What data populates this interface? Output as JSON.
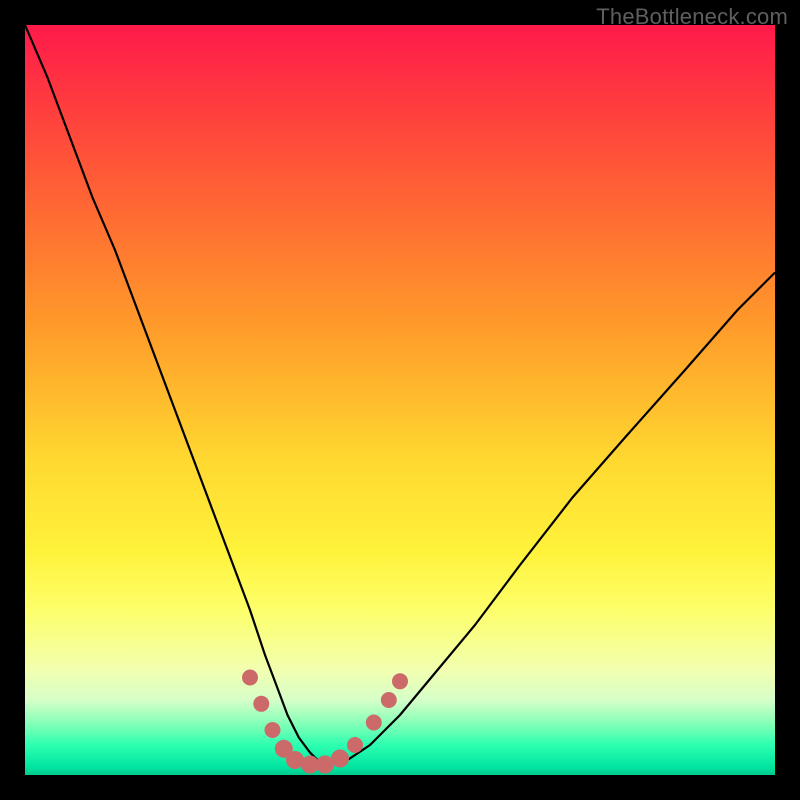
{
  "watermark": "TheBottleneck.com",
  "colors": {
    "frame": "#000000",
    "curve_stroke": "#000000",
    "dot_fill": "#cc6a6a",
    "gradient_top": "#ff1a4b",
    "gradient_bottom": "#00c98c"
  },
  "chart_data": {
    "type": "line",
    "title": "",
    "xlabel": "",
    "ylabel": "",
    "xlim": [
      0,
      100
    ],
    "ylim": [
      0,
      100
    ],
    "grid": false,
    "legend": false,
    "series": [
      {
        "name": "bottleneck-curve",
        "x": [
          0,
          3,
          6,
          9,
          12,
          15,
          18,
          21,
          24,
          27,
          30,
          32,
          33.5,
          35,
          36.5,
          38,
          39,
          40,
          41.5,
          43,
          46,
          50,
          55,
          60,
          66,
          73,
          80,
          88,
          95,
          100
        ],
        "y": [
          100,
          93,
          85,
          77,
          70,
          62,
          54,
          46,
          38,
          30,
          22,
          16,
          12,
          8,
          5,
          3,
          2,
          1.5,
          1.5,
          2,
          4,
          8,
          14,
          20,
          28,
          37,
          45,
          54,
          62,
          67
        ]
      }
    ],
    "markers": [
      {
        "x": 30,
        "y": 13
      },
      {
        "x": 31.5,
        "y": 9.5
      },
      {
        "x": 33,
        "y": 6
      },
      {
        "x": 34.5,
        "y": 3.5
      },
      {
        "x": 36,
        "y": 2
      },
      {
        "x": 38,
        "y": 1.4
      },
      {
        "x": 40,
        "y": 1.4
      },
      {
        "x": 42,
        "y": 2.2
      },
      {
        "x": 44,
        "y": 4
      },
      {
        "x": 46.5,
        "y": 7
      },
      {
        "x": 48.5,
        "y": 10
      },
      {
        "x": 50,
        "y": 12.5
      }
    ]
  }
}
